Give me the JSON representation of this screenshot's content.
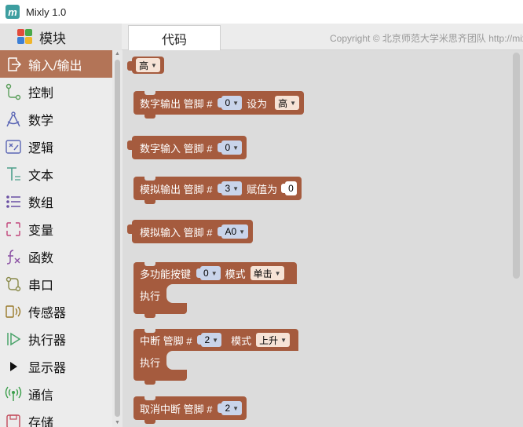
{
  "window": {
    "title": "Mixly 1.0",
    "icon": "mixly-logo-icon"
  },
  "header": {
    "modules_label": "模块",
    "code_tab_label": "代码",
    "copyright": "Copyright © 北京师范大学米思齐团队 http://mixly.org"
  },
  "sidebar": {
    "items": [
      {
        "label": "输入/输出",
        "icon": "io-icon",
        "active": true
      },
      {
        "label": "控制",
        "icon": "control-icon"
      },
      {
        "label": "数学",
        "icon": "math-compass-icon"
      },
      {
        "label": "逻辑",
        "icon": "logic-icon"
      },
      {
        "label": "文本",
        "icon": "text-icon"
      },
      {
        "label": "数组",
        "icon": "list-icon"
      },
      {
        "label": "变量",
        "icon": "variable-icon"
      },
      {
        "label": "函数",
        "icon": "function-icon"
      },
      {
        "label": "串口",
        "icon": "serial-icon"
      },
      {
        "label": "传感器",
        "icon": "sensor-icon"
      },
      {
        "label": "执行器",
        "icon": "actuator-icon"
      },
      {
        "label": "显示器",
        "icon": "display-icon"
      },
      {
        "label": "通信",
        "icon": "communication-icon"
      },
      {
        "label": "存储",
        "icon": "storage-icon"
      }
    ]
  },
  "blocks": {
    "high": {
      "value": "高"
    },
    "digital_write": {
      "label": "数字输出 管脚 #",
      "pin": "0",
      "set_label": "设为",
      "value": "高"
    },
    "digital_read": {
      "label": "数字输入 管脚 #",
      "pin": "0"
    },
    "analog_write": {
      "label": "模拟输出 管脚 #",
      "pin": "3",
      "assign_label": "赋值为",
      "value": "0"
    },
    "analog_read": {
      "label": "模拟输入 管脚 #",
      "pin": "A0"
    },
    "button": {
      "label": "多功能按键",
      "pin": "0",
      "mode_label": "模式",
      "mode": "单击",
      "exec_label": "执行"
    },
    "interrupt": {
      "label": "中断 管脚 #",
      "pin": "2",
      "mode_label": "模式",
      "mode": "上升",
      "exec_label": "执行"
    },
    "detach_interrupt": {
      "label": "取消中断 管脚 #",
      "pin": "2"
    }
  },
  "colors": {
    "block": "#a55b3e",
    "active_category": "#b37457",
    "number_field": "#c9d4ea",
    "dropdown_field": "#f6e3d6"
  }
}
